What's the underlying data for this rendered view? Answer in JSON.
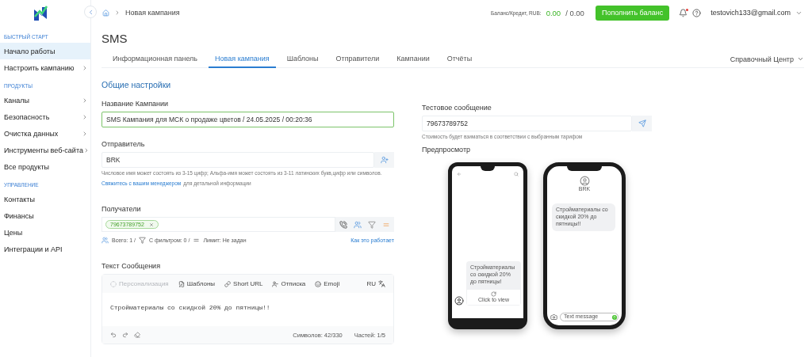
{
  "sidebar": {
    "sections": [
      {
        "heading": "БЫСТРЫЙ СТАРТ",
        "items": [
          {
            "label": "Начало работы",
            "selected": true,
            "expandable": false
          },
          {
            "label": "Настроить кампанию",
            "selected": false,
            "expandable": true
          }
        ]
      },
      {
        "heading": "ПРОДУКТЫ",
        "items": [
          {
            "label": "Каналы",
            "selected": false,
            "expandable": true
          },
          {
            "label": "Безопасность",
            "selected": false,
            "expandable": true
          },
          {
            "label": "Очистка данных",
            "selected": false,
            "expandable": true
          },
          {
            "label": "Инструменты веб-сайта",
            "selected": false,
            "expandable": true
          },
          {
            "label": "Все продукты",
            "selected": false,
            "expandable": false
          }
        ]
      },
      {
        "heading": "УПРАВЛЕНИЕ",
        "items": [
          {
            "label": "Контакты",
            "selected": false,
            "expandable": false
          },
          {
            "label": "Финансы",
            "selected": false,
            "expandable": false
          },
          {
            "label": "Цены",
            "selected": false,
            "expandable": false
          },
          {
            "label": "Интеграции и API",
            "selected": false,
            "expandable": false
          }
        ]
      }
    ]
  },
  "topbar": {
    "breadcrumb": "Новая кампания",
    "balance_label": "Баланс/Кредит, RUB:",
    "balance": "0.00",
    "credit": "/ 0.00",
    "topup_button": "Пополнить баланс",
    "has_unread_notifications": true,
    "user": "testovich133@gmail.com"
  },
  "page": {
    "title": "SMS",
    "tabs": [
      {
        "label": "Информационная панель",
        "selected": false
      },
      {
        "label": "Новая кампания",
        "selected": true
      },
      {
        "label": "Шаблоны",
        "selected": false
      },
      {
        "label": "Отправители",
        "selected": false
      },
      {
        "label": "Кампании",
        "selected": false
      },
      {
        "label": "Отчёты",
        "selected": false
      }
    ],
    "help_center": "Справочный Центр"
  },
  "form": {
    "section_title": "Общие настройки",
    "campaign_name": {
      "label": "Название Кампании",
      "value": "SMS Кампания для МСК о продаже цветов / 24.05.2025 / 00:20:36"
    },
    "sender": {
      "label": "Отправитель",
      "value": "BRK",
      "hint": "Числовое имя может состоять из 3-15 цифр; Альфа-имя может состоять из 3-11 латинских букв,цифр или символов.",
      "link": "Свяжитесь с вашим менеджером",
      "link_suffix": "для детальной информации"
    },
    "recipients": {
      "label": "Получатели",
      "chips": [
        "79673789752"
      ],
      "stats": [
        {
          "kind": "total",
          "text": "Всего: 1 /"
        },
        {
          "kind": "filter",
          "text": "С фильтром: 0 /"
        },
        {
          "kind": "limit",
          "text": "Лимит: Не задан"
        }
      ],
      "how_link": "Как это работает"
    },
    "message": {
      "label": "Текст Сообщения",
      "toolbar": [
        {
          "kind": "personalize",
          "label": "Персонализация",
          "disabled": true
        },
        {
          "kind": "templates",
          "label": "Шаблоны",
          "disabled": false
        },
        {
          "kind": "url",
          "label": "Short URL",
          "disabled": false
        },
        {
          "kind": "unsubscribe",
          "label": "Отписка",
          "disabled": false
        },
        {
          "kind": "emoji",
          "label": "Emoji",
          "disabled": false
        }
      ],
      "language": "RU",
      "text": "Стройматериалы со скидкой 20% до пятницы!!",
      "counter": "Символов: 42/330",
      "parts": "Частей: 1/5"
    }
  },
  "test_message": {
    "label": "Тестовое сообщение",
    "value": "79673789752",
    "hint": "Стоимость будет взиматься в соответствии с выбранным тарифом"
  },
  "preview": {
    "label": "Предпросмотр",
    "android": {
      "message": "Стройматериалы со скидкой 20% до пятницы!",
      "action": "Click to view"
    },
    "ios": {
      "sender": "BRK",
      "message": "Стройматериалы со скидкой 20% до пятницы!!",
      "input_placeholder": "Text message"
    }
  }
}
